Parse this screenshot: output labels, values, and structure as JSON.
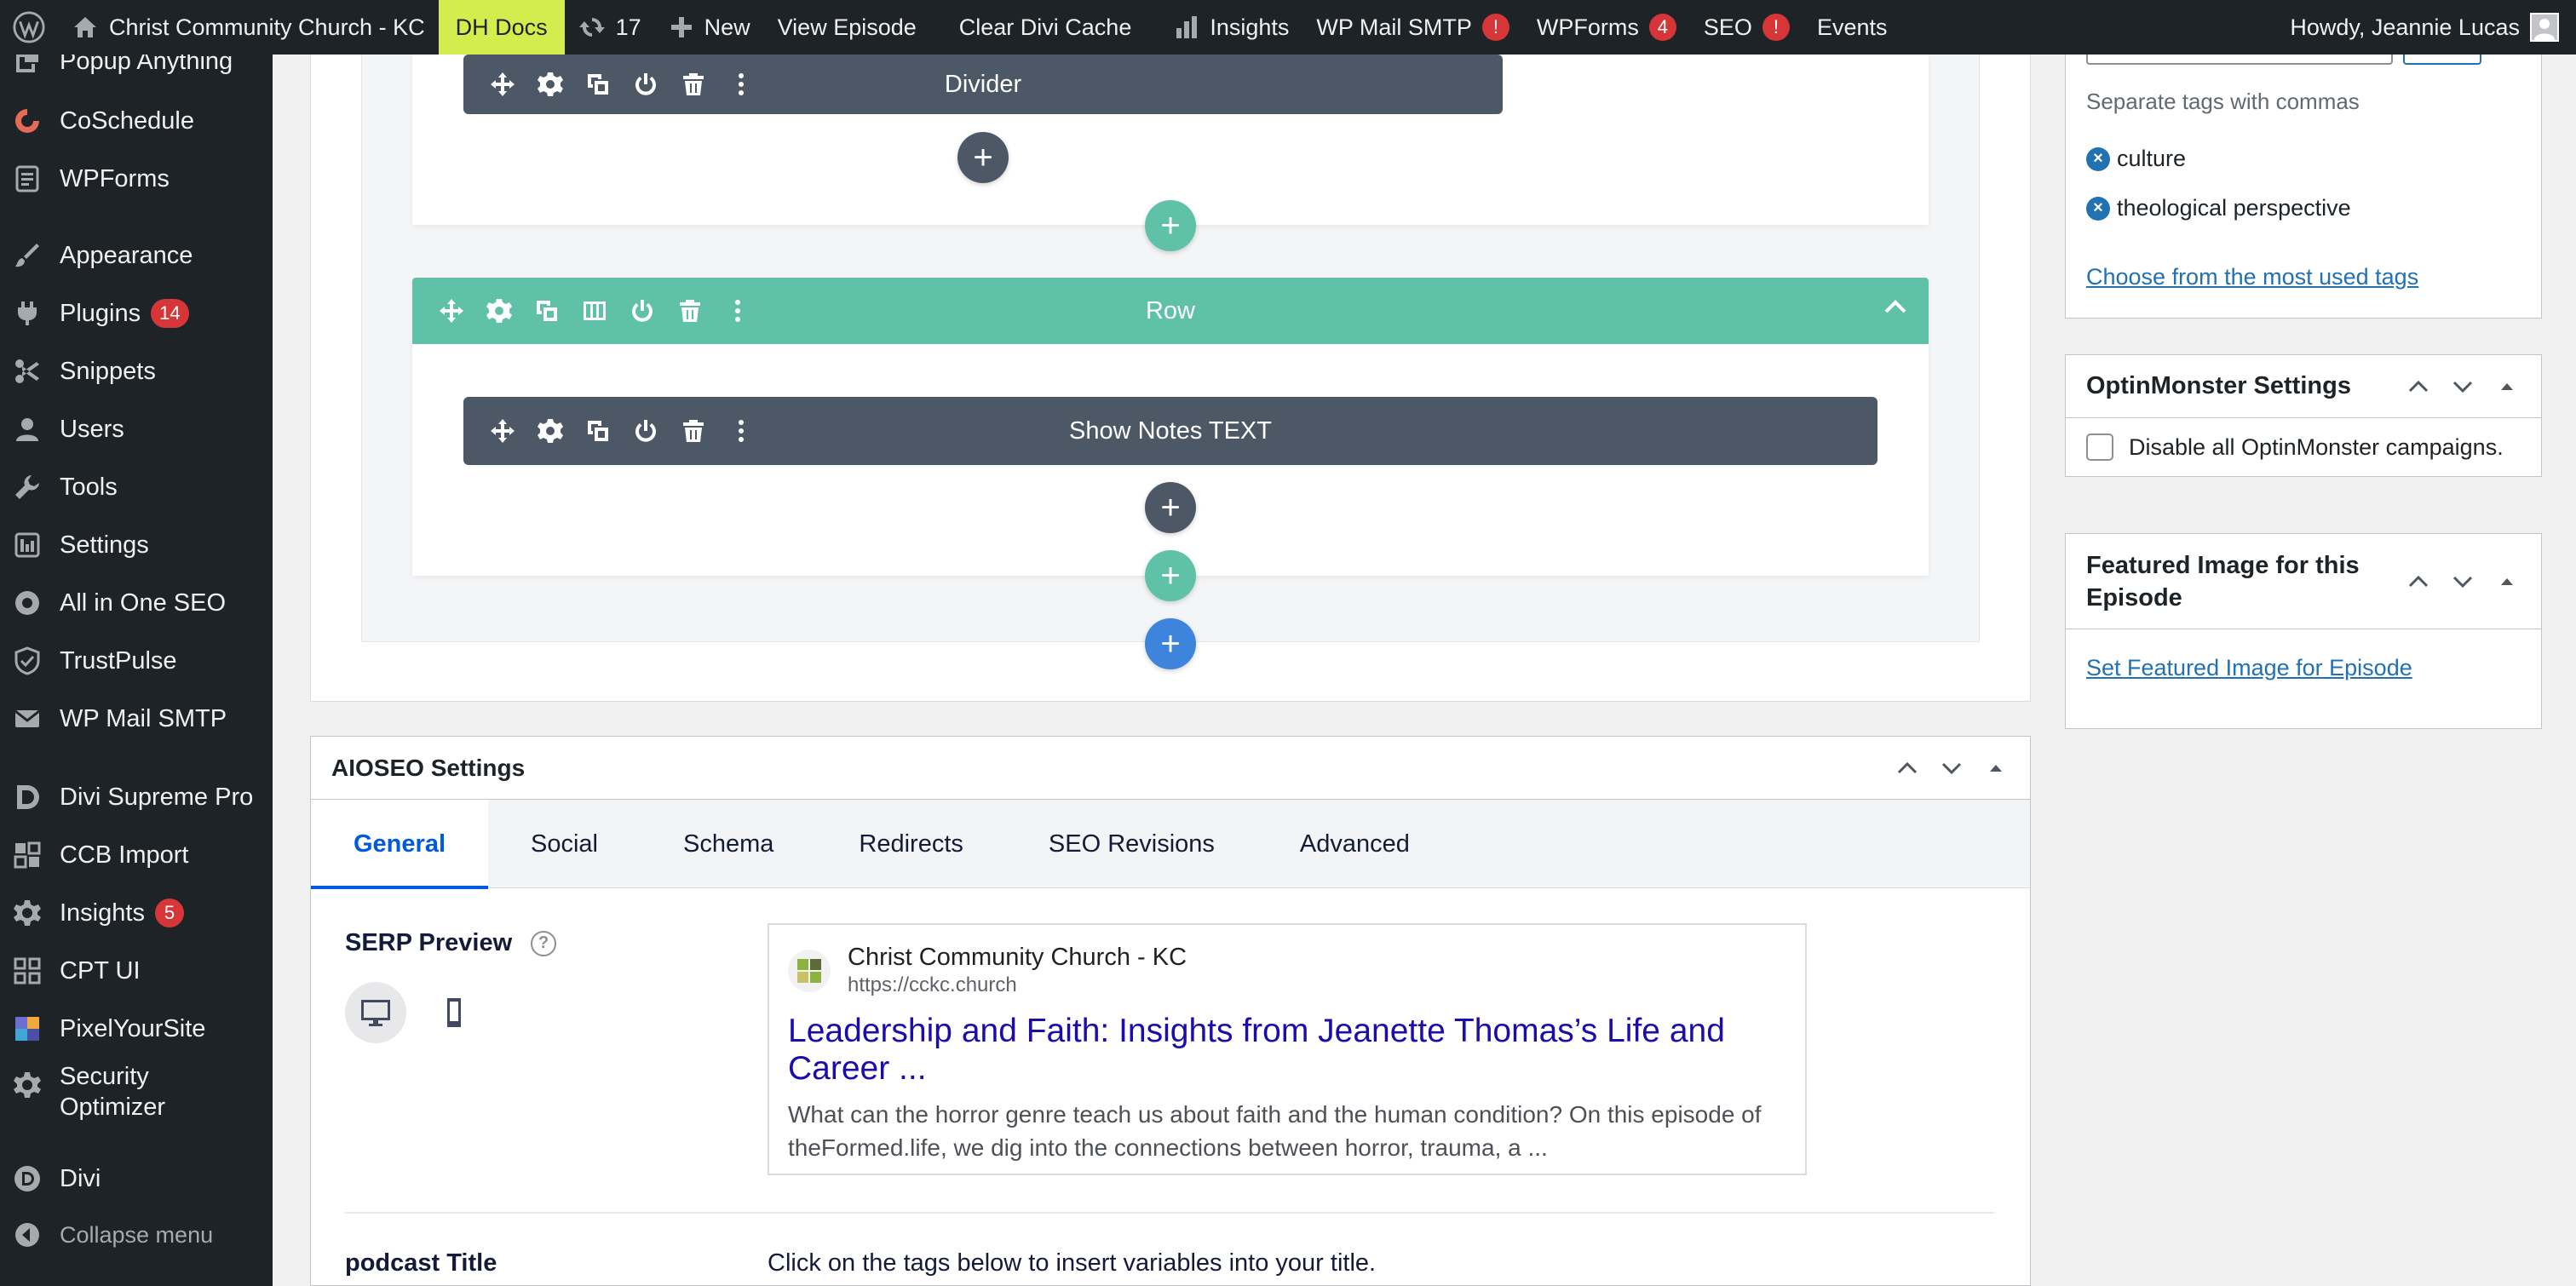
{
  "admin_bar": {
    "site_name": "Christ Community Church - KC",
    "dh_docs": "DH Docs",
    "updates_count": "17",
    "new_label": "New",
    "view_episode": "View Episode",
    "clear_cache": "Clear Divi Cache",
    "insights": "Insights",
    "wp_mail_smtp": "WP Mail SMTP",
    "wp_mail_smtp_badge": "!",
    "wpforms": "WPForms",
    "wpforms_badge": "4",
    "seo": "SEO",
    "seo_badge": "!",
    "events": "Events",
    "howdy": "Howdy, Jeannie Lucas"
  },
  "sidebar": {
    "items": [
      {
        "label": "Popup Anything",
        "icon": "popup-icon"
      },
      {
        "label": "CoSchedule",
        "icon": "coschedule-icon"
      },
      {
        "label": "WPForms",
        "icon": "wpforms-icon"
      },
      {
        "label": "Appearance",
        "icon": "appearance-brush-icon"
      },
      {
        "label": "Plugins",
        "icon": "plugins-icon",
        "badge": "14"
      },
      {
        "label": "Snippets",
        "icon": "snippets-scissors-icon"
      },
      {
        "label": "Users",
        "icon": "users-icon"
      },
      {
        "label": "Tools",
        "icon": "tools-wrench-icon"
      },
      {
        "label": "Settings",
        "icon": "settings-icon"
      },
      {
        "label": "All in One SEO",
        "icon": "aioseo-icon"
      },
      {
        "label": "TrustPulse",
        "icon": "trustpulse-shield-icon"
      },
      {
        "label": "WP Mail SMTP",
        "icon": "mail-icon"
      },
      {
        "label": "Divi Supreme Pro",
        "icon": "divi-supreme-icon"
      },
      {
        "label": "CCB Import",
        "icon": "import-icon"
      },
      {
        "label": "Insights",
        "icon": "insights-gear-icon",
        "badge": "5"
      },
      {
        "label": "CPT UI",
        "icon": "cpt-ui-icon"
      },
      {
        "label": "PixelYourSite",
        "icon": "pixelyoursite-icon"
      },
      {
        "label": "Security Optimizer",
        "icon": "security-gear-icon"
      },
      {
        "label": "Divi",
        "icon": "divi-icon"
      }
    ],
    "collapse_label": "Collapse menu"
  },
  "builder": {
    "divider_module": "Divider",
    "row_label": "Row",
    "show_notes_module": "Show Notes TEXT",
    "add_symbol": "+"
  },
  "aioseo": {
    "title": "AIOSEO Settings",
    "tabs": [
      "General",
      "Social",
      "Schema",
      "Redirects",
      "SEO Revisions",
      "Advanced"
    ],
    "active_tab": "General",
    "serp_label": "SERP Preview",
    "help_symbol": "?",
    "serp": {
      "site_name": "Christ Community Church - KC",
      "url": "https://cckc.church",
      "title": "Leadership and Faith: Insights from Jeanette Thomas’s Life and Career ...",
      "description": "What can the horror genre teach us about faith and the human condition? On this episode of theFormed.life, we dig into the connections between horror, trauma, a ..."
    },
    "podcast_title_label": "podcast Title",
    "podcast_title_help": "Click on the tags below to insert variables into your title."
  },
  "tags_box": {
    "hint": "Separate tags with commas",
    "tags": [
      "culture",
      "theological perspective"
    ],
    "remove_symbol": "×",
    "most_used_link": "Choose from the most used tags"
  },
  "optinmonster": {
    "title": "OptinMonster Settings",
    "checkbox_label": "Disable all OptinMonster campaigns."
  },
  "featured_image": {
    "title": "Featured Image for this Episode",
    "link": "Set Featured Image for Episode"
  },
  "colors": {
    "admin_bar_bg": "#1d2327",
    "dh_docs_bg": "#d4ed4e",
    "badge_red": "#d63638",
    "divi_module": "#4c5866",
    "divi_row": "#5fc2a8",
    "divi_section_add": "#3d84dc",
    "aioseo_active_tab": "#005ae0",
    "serp_title": "#1a0dab",
    "wp_link": "#2271b1"
  }
}
